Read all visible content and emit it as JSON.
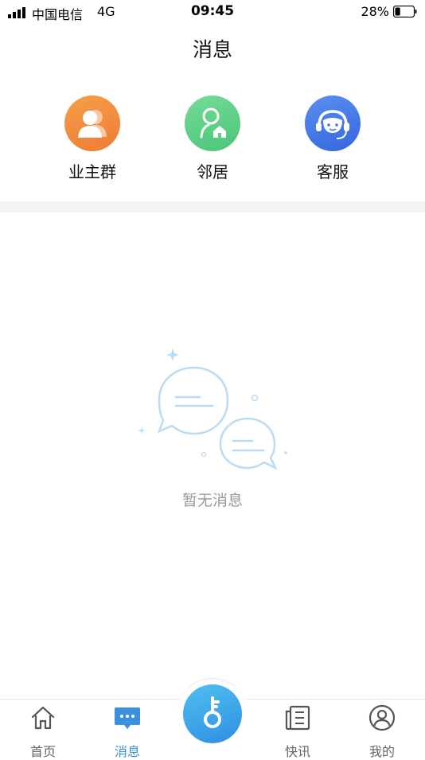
{
  "status": {
    "carrier": "中国电信",
    "network": "4G",
    "time": "09:45",
    "battery_percent": "28%",
    "battery_level": 0.28
  },
  "page": {
    "title": "消息"
  },
  "categories": [
    {
      "label": "业主群",
      "icon": "owners-group-icon",
      "color": "#f28a3c"
    },
    {
      "label": "邻居",
      "icon": "neighbor-icon",
      "color": "#5fcf86"
    },
    {
      "label": "客服",
      "icon": "customer-service-icon",
      "color": "#3f74e6"
    }
  ],
  "empty_state": {
    "text": "暂无消息",
    "icon": "chat-bubbles-icon"
  },
  "tabbar": {
    "items": [
      {
        "label": "首页",
        "icon": "home-icon"
      },
      {
        "label": "消息",
        "icon": "message-icon",
        "active": true
      },
      {
        "label": "",
        "icon": "key-icon"
      },
      {
        "label": "快讯",
        "icon": "news-icon"
      },
      {
        "label": "我的",
        "icon": "profile-icon"
      }
    ],
    "active_color": "#3d8fe0"
  }
}
